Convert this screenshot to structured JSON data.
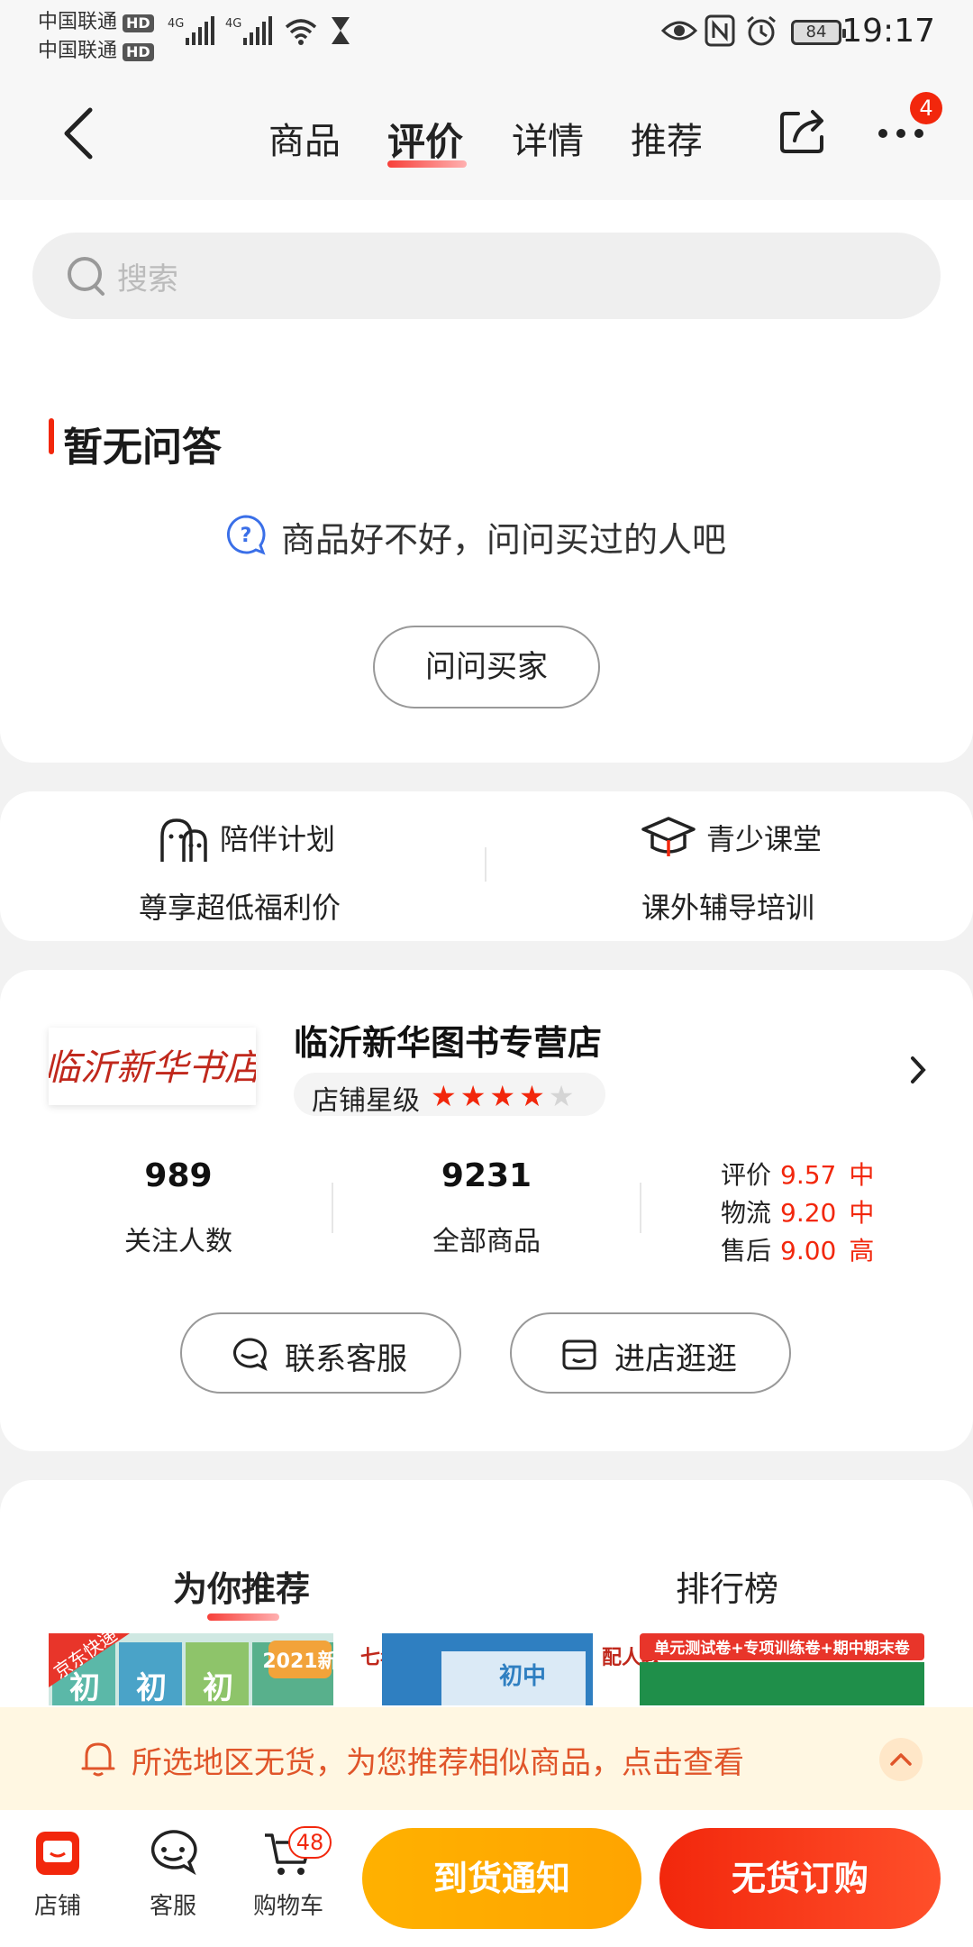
{
  "status_bar": {
    "carrier1": "中国联通",
    "carrier2": "中国联通",
    "hd": "HD",
    "network": "4G",
    "battery": "84",
    "time": "19:17"
  },
  "nav": {
    "tabs": [
      "商品",
      "评价",
      "详情",
      "推荐"
    ],
    "active_tab": "评价",
    "more_badge": "4"
  },
  "search": {
    "placeholder": "搜索"
  },
  "qa": {
    "title": "暂无问答",
    "hint": "商品好不好，问问买过的人吧",
    "ask_button": "问问买家"
  },
  "promos": [
    {
      "title": "陪伴计划",
      "subtitle": "尊享超低福利价"
    },
    {
      "title": "青少课堂",
      "subtitle": "课外辅导培训"
    }
  ],
  "shop": {
    "logo_text": "临沂新华书店",
    "name": "临沂新华图书专营店",
    "rating_label": "店铺星级",
    "stars_filled": 4,
    "stars_total": 5,
    "followers": "989",
    "followers_label": "关注人数",
    "products": "9231",
    "products_label": "全部商品",
    "scores": [
      {
        "label": "评价",
        "value": "9.57",
        "level": "中"
      },
      {
        "label": "物流",
        "value": "9.20",
        "level": "中"
      },
      {
        "label": "售后",
        "value": "9.00",
        "level": "高"
      }
    ],
    "contact_button": "联系客服",
    "visit_button": "进店逛逛"
  },
  "recommend": {
    "tabs": [
      "为你推荐",
      "排行榜"
    ],
    "thumb1_badge": "京东快递",
    "thumb1_corner": "2021新",
    "thumb1_text": "初",
    "thumb2_text": "初中",
    "thumb2_side": "七年级",
    "thumb3_banner": "单元测试卷+专项训练卷+期中期末卷",
    "thumb3_side": "配人教"
  },
  "notice": {
    "text": "所选地区无货，为您推荐相似商品，点击查看"
  },
  "bottom": {
    "shop": "店铺",
    "service": "客服",
    "cart": "购物车",
    "cart_count": "48",
    "notify": "到货通知",
    "order": "无货订购"
  },
  "colors": {
    "accent": "#f2270c",
    "notify": "#ffa400",
    "notice_bg": "#fff7e2"
  }
}
